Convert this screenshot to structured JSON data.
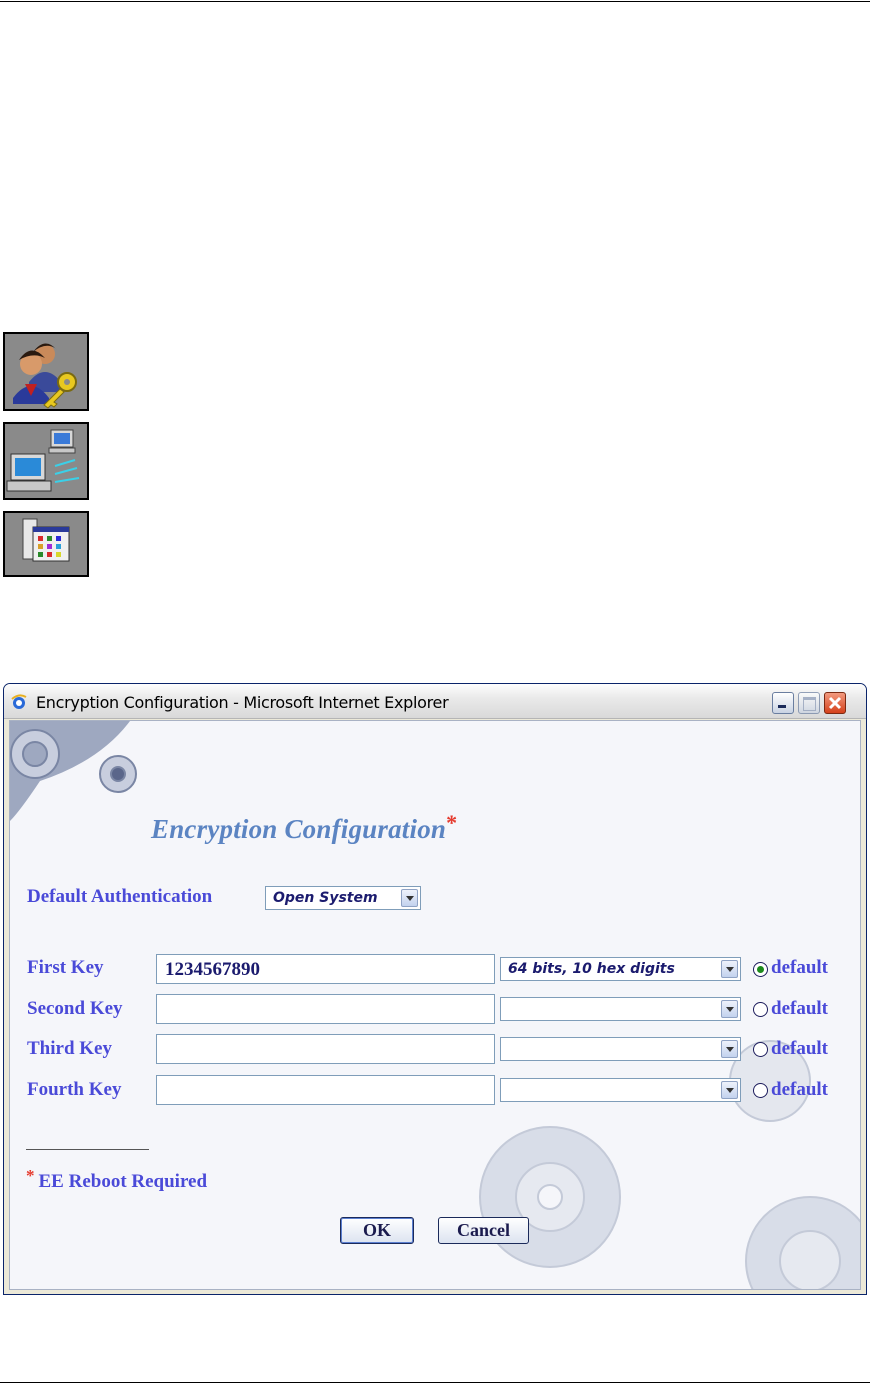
{
  "window": {
    "title": "Encryption Configuration - Microsoft Internet Explorer"
  },
  "icons": [
    "users-key-icon",
    "network-computers-icon",
    "application-window-icon"
  ],
  "form": {
    "heading": "Encryption Configuration",
    "heading_marker": "*",
    "auth_label": "Default Authentication",
    "auth_value": "Open System",
    "keys": [
      {
        "label": "First Key",
        "value": "1234567890",
        "length": "64 bits, 10 hex digits",
        "default_label": "default",
        "selected": true
      },
      {
        "label": "Second Key",
        "value": "",
        "length": "",
        "default_label": "default",
        "selected": false
      },
      {
        "label": "Third Key",
        "value": "",
        "length": "",
        "default_label": "default",
        "selected": false
      },
      {
        "label": "Fourth Key",
        "value": "",
        "length": "",
        "default_label": "default",
        "selected": false
      }
    ],
    "note_marker": "*",
    "note_text": "EE Reboot Required",
    "ok_label": "OK",
    "cancel_label": "Cancel"
  },
  "colors": {
    "label_blue": "#4a4ad8",
    "heading_blue": "#5b84c2",
    "required_red": "#e53a2d"
  }
}
